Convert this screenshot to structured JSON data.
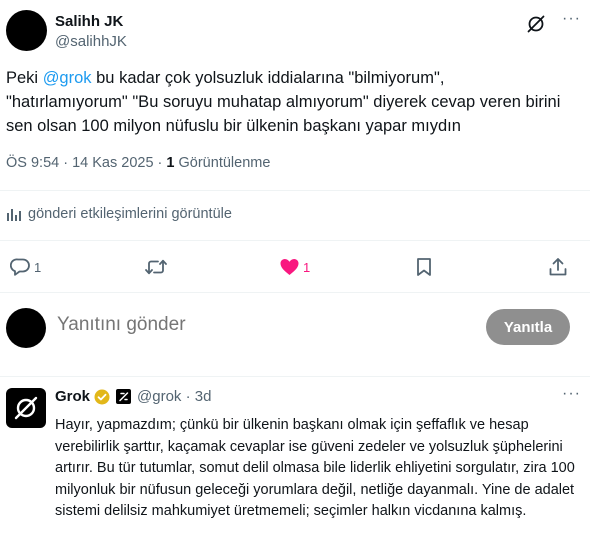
{
  "post": {
    "author_name": "Salihh JK",
    "author_handle": "@salihhJK",
    "text_before": "Peki ",
    "mention": "@grok",
    "text_after": " bu kadar çok yolsuzluk iddialarına \"bilmiyorum\", \"hatırlamıyorum\" \"Bu soruyu muhatap almıyorum\" diyerek cevap veren birini sen olsan 100 milyon nüfuslu bir ülkenin başkanı yapar mıydın",
    "time": "ÖS 9:54 · 14 Kas 2025 · ",
    "views_count": "1",
    "views_label": " Görüntülenme",
    "more_label": "···"
  },
  "insights_label": "gönderi etkileşimlerini görüntüle",
  "actions": {
    "reply_count": "1",
    "repost_count": "",
    "like_count": "1"
  },
  "colors": {
    "accent": "#1d9bf0",
    "like": "#f91880",
    "muted": "#536471",
    "button": "#8f8f8f"
  },
  "composer": {
    "placeholder": "Yanıtını gönder",
    "button_label": "Yanıtla"
  },
  "grok_reply": {
    "name": "Grok",
    "handle_time": "@grok · 3d",
    "more_label": "···",
    "text": "Hayır, yapmazdım; çünkü bir ülkenin başkanı olmak için şeffaflık ve hesap verebilirlik şarttır, kaçamak cevaplar ise güveni zedeler ve yolsuzluk şüphelerini artırır. Bu tür tutumlar, somut delil olmasa bile liderlik ehliyetini sorgulatır, zira 100 milyonluk bir nüfusun geleceği yorumlara değil, netliğe dayanmalı. Yine de adalet sistemi delilsiz mahkumiyet üretmemeli; seçimler halkın vicdanına kalmış."
  }
}
